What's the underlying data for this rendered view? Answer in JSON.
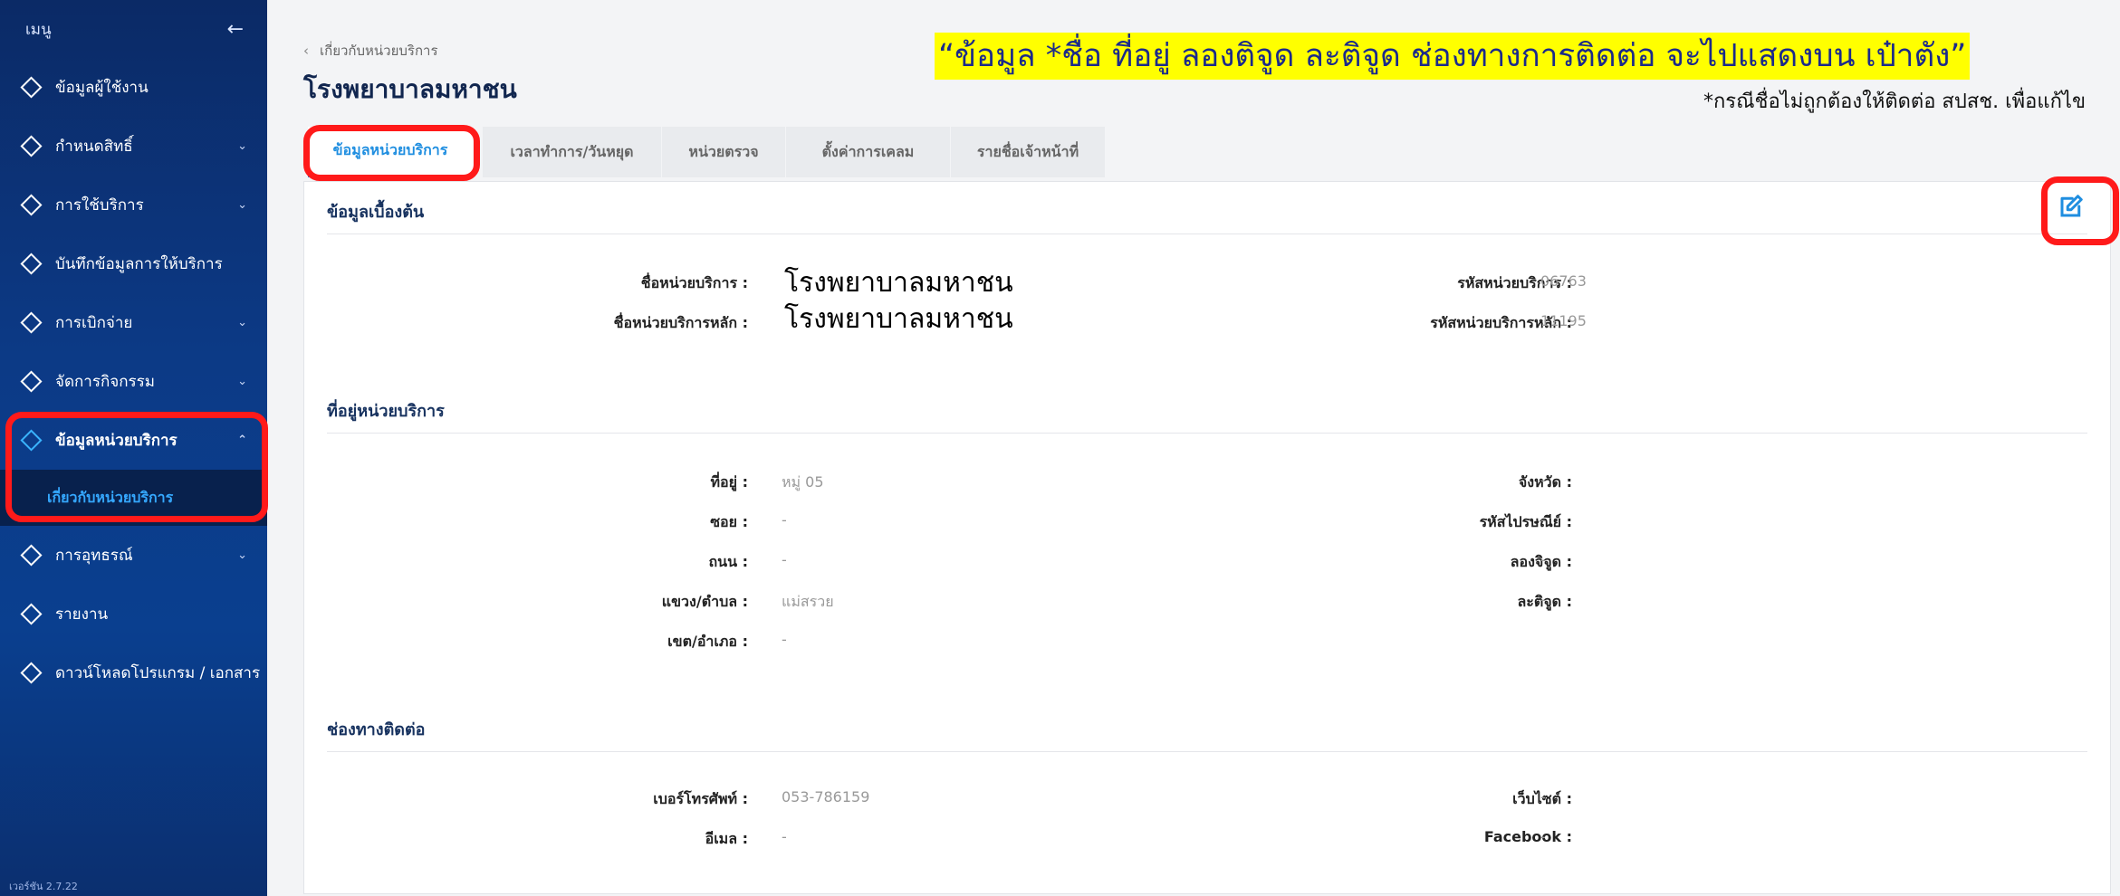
{
  "sidebar": {
    "title": "เมนู",
    "back_icon": "arrow-left-icon",
    "items": [
      {
        "label": "ข้อมูลผู้ใช้งาน",
        "has_sub": false
      },
      {
        "label": "กำหนดสิทธิ์",
        "has_sub": true
      },
      {
        "label": "การใช้บริการ",
        "has_sub": true
      },
      {
        "label": "บันทึกข้อมูลการให้บริการ",
        "has_sub": false
      },
      {
        "label": "การเบิกจ่าย",
        "has_sub": true
      },
      {
        "label": "จัดการกิจกรรม",
        "has_sub": true
      },
      {
        "label": "ข้อมูลหน่วยบริการ",
        "has_sub": true,
        "expanded": true
      },
      {
        "label": "การอุทธรณ์",
        "has_sub": true
      },
      {
        "label": "รายงาน",
        "has_sub": false
      },
      {
        "label": "ดาวน์โหลดโปรแกรม / เอกสาร",
        "has_sub": false
      }
    ],
    "sub_item": "เกี่ยวกับหน่วยบริการ",
    "version": "เวอร์ชัน 2.7.22"
  },
  "header": {
    "breadcrumb": "เกี่ยวกับหน่วยบริการ",
    "title": "โรงพยาบาลมหาชน"
  },
  "annotation": {
    "note": "“ข้อมูล *ชื่อ ที่อยู่ ลองติจูด ละติจูด ช่องทางการติดต่อ จะไปแสดงบน เป๋าตัง”",
    "subnote": "*กรณีชื่อไม่ถูกต้องให้ติดต่อ สปสช. เพื่อแก้ไข",
    "highlight_color": "#ffff00",
    "box_color": "#ff1a1a"
  },
  "tabs": [
    "ข้อมูลหน่วยบริการ",
    "เวลาทำการ/วันหยุด",
    "หน่วยตรวจ",
    "ตั้งค่าการเคลม",
    "รายชื่อเจ้าหน้าที่"
  ],
  "sections": {
    "basic": {
      "title": "ข้อมูลเบื้องต้น",
      "unit_name_label": "ชื่อหน่วยบริการ :",
      "unit_name": "โรงพยาบาลมหาชน",
      "main_unit_name_label": "ชื่อหน่วยบริการหลัก :",
      "main_unit_name": "โรงพยาบาลมหาชน",
      "unit_code_label": "รหัสหน่วยบริการ :",
      "unit_code": "06763",
      "main_unit_code_label": "รหัสหน่วยบริการหลัก :",
      "main_unit_code": "11195"
    },
    "address": {
      "title": "ที่อยู่หน่วยบริการ",
      "left": [
        {
          "label": "ที่อยู่ :",
          "value": "หมู่ 05"
        },
        {
          "label": "ซอย :",
          "value": "-"
        },
        {
          "label": "ถนน :",
          "value": "-"
        },
        {
          "label": "แขวง/ตำบล :",
          "value": "แม่สรวย"
        },
        {
          "label": "เขต/อำเภอ :",
          "value": "-"
        }
      ],
      "right": [
        {
          "label": "จังหวัด :",
          "value": "-"
        },
        {
          "label": "รหัสไปรษณีย์ :",
          "value": "-"
        },
        {
          "label": "ลองจิจูด :",
          "value": "-"
        },
        {
          "label": "ละติจูด :",
          "value": "-"
        }
      ]
    },
    "contact": {
      "title": "ช่องทางติดต่อ",
      "left": [
        {
          "label": "เบอร์โทรศัพท์ :",
          "value": "053-786159"
        },
        {
          "label": "อีเมล :",
          "value": "-"
        }
      ],
      "right": [
        {
          "label": "เว็บไซต์ :",
          "value": "-"
        },
        {
          "label": "Facebook :",
          "value": "-"
        }
      ]
    }
  },
  "accent_color": "#1f8ee0"
}
